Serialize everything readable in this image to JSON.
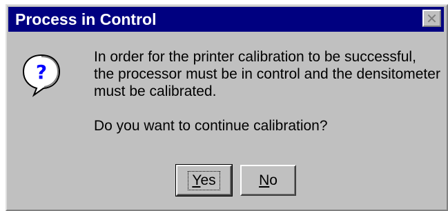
{
  "window": {
    "title": "Process in Control",
    "close_symbol": "✕"
  },
  "icon": {
    "name": "question-icon",
    "glyph": "?"
  },
  "message": {
    "lines": [
      "In order for the printer calibration to be successful,",
      "the processor must be in control and the densitometer",
      "must be calibrated."
    ],
    "prompt": "Do you want to continue calibration?"
  },
  "buttons": {
    "yes": {
      "accel": "Y",
      "rest": "es"
    },
    "no": {
      "accel": "N",
      "rest": "o"
    }
  },
  "colors": {
    "titlebar": "#000080",
    "dialog_face": "#c0c0c0"
  }
}
